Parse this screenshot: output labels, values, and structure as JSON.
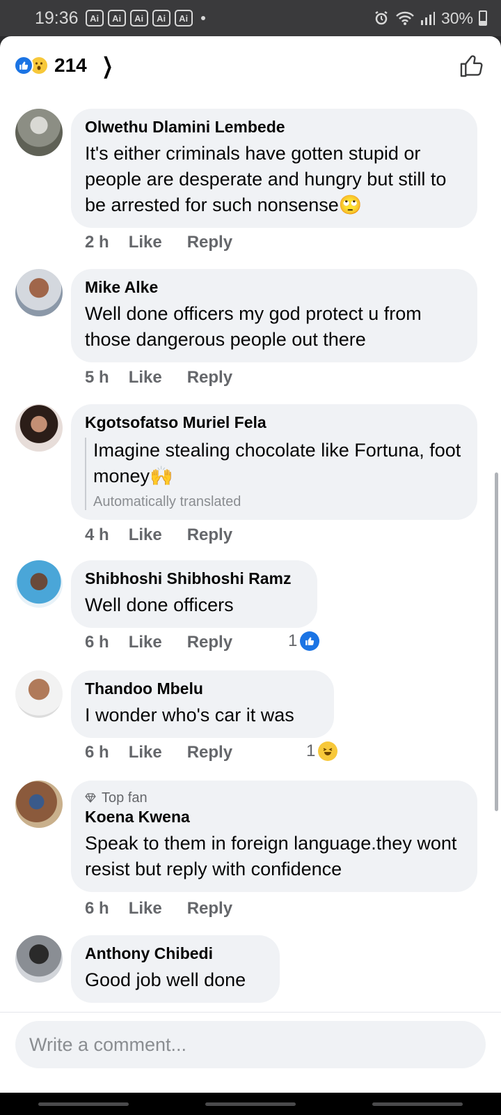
{
  "status_bar": {
    "time": "19:36",
    "badges": [
      "Ai",
      "Ai",
      "Ai",
      "Ai",
      "Ai"
    ],
    "battery": "30%"
  },
  "header": {
    "reaction_count": "214",
    "reactions": [
      "like",
      "wow"
    ]
  },
  "comments": [
    {
      "author": "Olwethu Dlamini Lembede",
      "text": "It's either criminals have gotten stupid or people are desperate and hungry but still to be arrested for such nonsense🙄",
      "time": "2 h",
      "like_label": "Like",
      "reply_label": "Reply"
    },
    {
      "author": "Mike Alke",
      "text": "Well done officers  my  god protect u from  those  dangerous people out there",
      "time": "5 h",
      "like_label": "Like",
      "reply_label": "Reply"
    },
    {
      "author": "Kgotsofatso Muriel Fela",
      "text": "Imagine stealing chocolate like Fortuna, foot money🙌",
      "translated_note": "Automatically translated",
      "time": "4 h",
      "like_label": "Like",
      "reply_label": "Reply"
    },
    {
      "author": "Shibhoshi Shibhoshi Ramz",
      "text": "Well done officers",
      "time": "6 h",
      "like_label": "Like",
      "reply_label": "Reply",
      "reaction_count": "1",
      "reaction": "like"
    },
    {
      "author": "Thandoo Mbelu",
      "text": "I wonder who's car it was",
      "time": "6 h",
      "like_label": "Like",
      "reply_label": "Reply",
      "reaction_count": "1",
      "reaction": "haha"
    },
    {
      "badge": "Top fan",
      "author": "Koena Kwena",
      "text": "Speak to them in foreign language.they wont resist but reply with confidence",
      "time": "6 h",
      "like_label": "Like",
      "reply_label": "Reply"
    },
    {
      "author": "Anthony Chibedi",
      "text": "Good job well done"
    }
  ],
  "composer": {
    "placeholder": "Write a comment..."
  },
  "colors": {
    "accent": "#1b74e4",
    "bubble": "#f0f2f5",
    "secondary_text": "#65676b"
  }
}
